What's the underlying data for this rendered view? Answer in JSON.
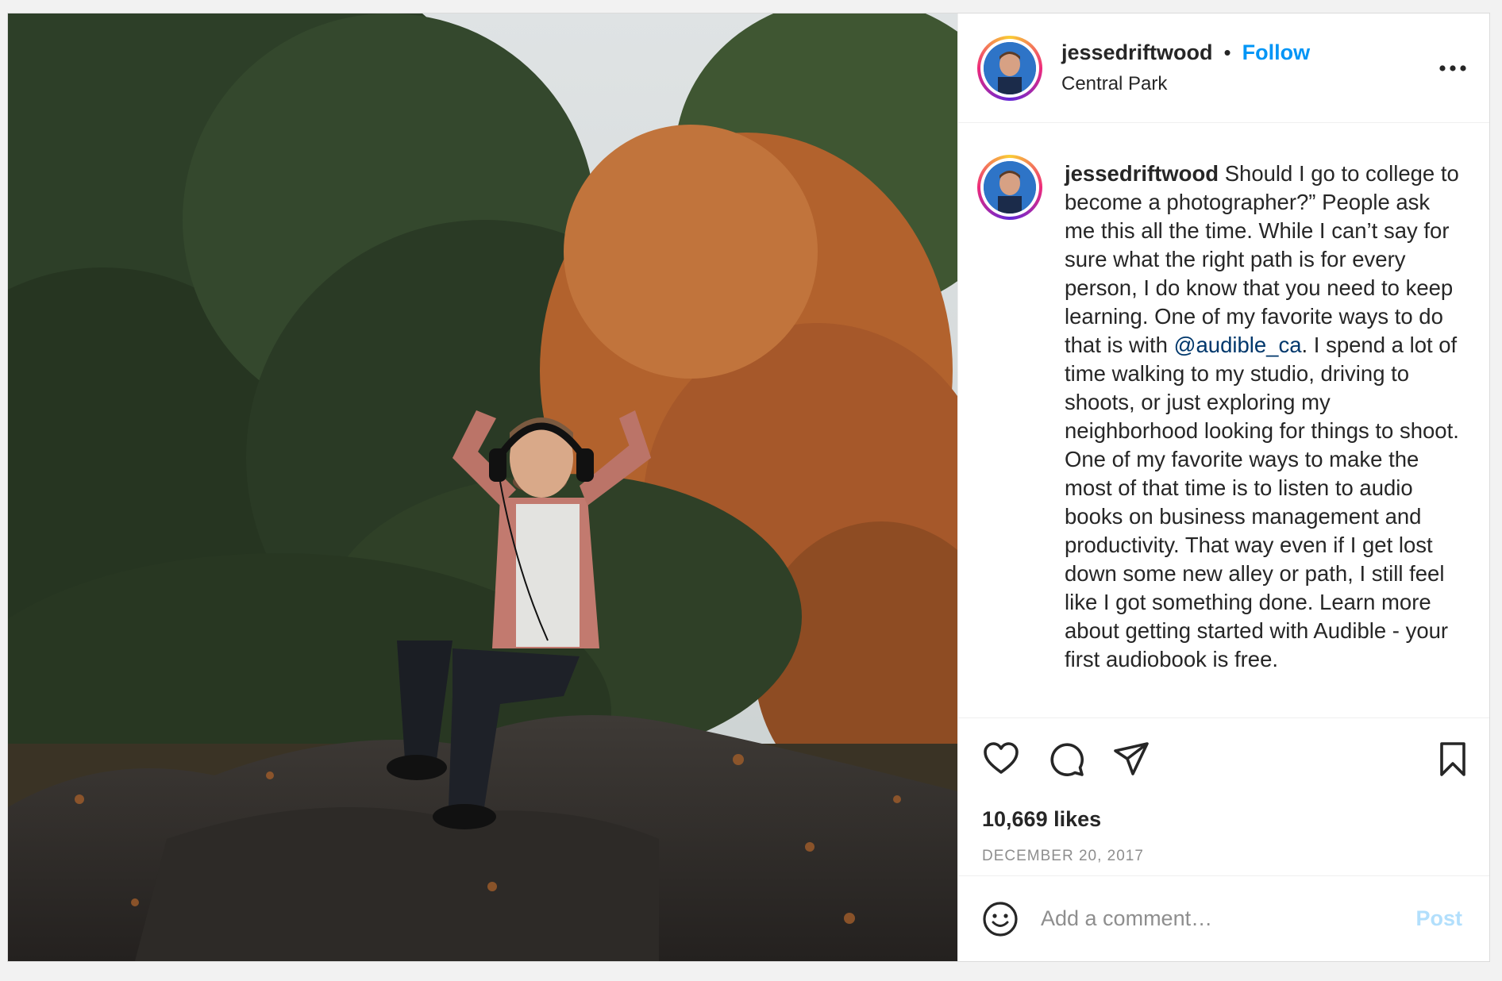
{
  "post": {
    "username": "jessedriftwood",
    "separator": "•",
    "follow_label": "Follow",
    "location": "Central Park",
    "more_icon": "more-horizontal-icon",
    "caption": {
      "username": "jessedriftwood",
      "text_before_mention": " Should I go to college to become a photographer?” People ask me this all the time. While I can’t say for sure what the right path is for every person, I do know that you need to keep learning. One of my favorite ways to do that is with ",
      "mention": "@audible_ca",
      "text_after_mention": ". I spend a lot of time walking to my studio, driving to shoots, or just exploring my neighborhood looking for things to shoot. One of my favorite ways to make the most of that time is to listen to audio books on business management and productivity. That way even if I get lost down some new alley or path, I still feel like I got something done. Learn more about getting started with Audible - your first audiobook is free."
    },
    "actions": [
      "heart-icon",
      "comment-icon",
      "share-icon",
      "bookmark-icon"
    ],
    "likes": "10,669 likes",
    "date": "DECEMBER 20, 2017",
    "comment": {
      "placeholder": "Add a comment…",
      "post_label": "Post",
      "emoji_icon": "smiley-icon"
    }
  },
  "colors": {
    "link_blue": "#0095f6",
    "mention_blue": "#00376b",
    "post_disabled": "#b2dffc",
    "muted_text": "#8e8e8e"
  }
}
